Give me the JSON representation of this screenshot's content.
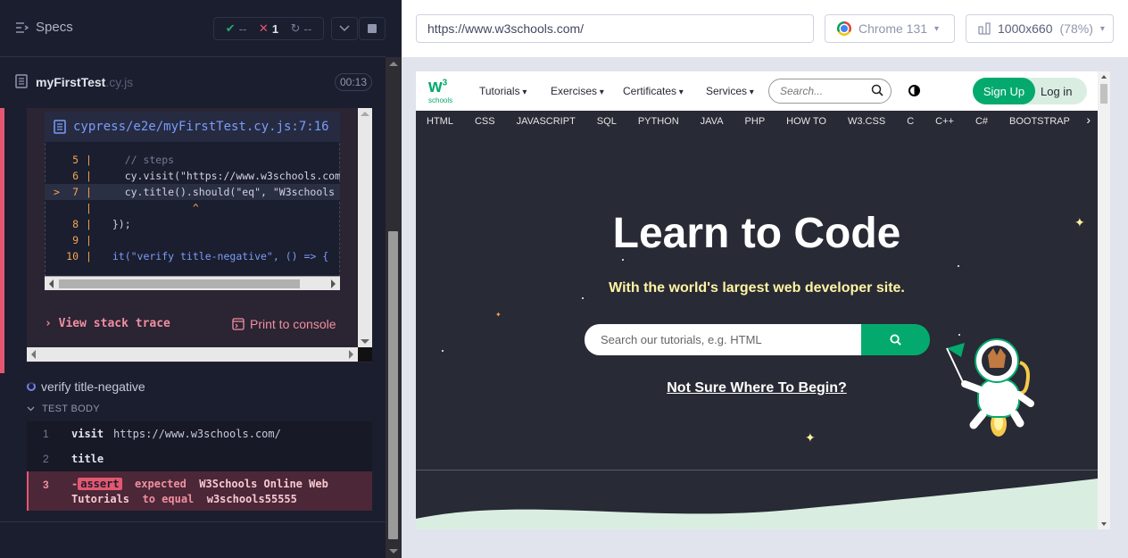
{
  "reporter": {
    "specs_label": "Specs",
    "stats": {
      "passed": "--",
      "failed": "1",
      "pending": "--"
    },
    "spec_file": {
      "name": "myFirstTest",
      "ext": ".cy.js",
      "duration": "00:13"
    },
    "error": {
      "location": "cypress/e2e/myFirstTest.cy.js:7:16",
      "code_lines": [
        {
          "num": "5",
          "text": "    // steps"
        },
        {
          "num": "6",
          "text": "    cy.visit(\"https://www.w3schools.com"
        },
        {
          "num": "7",
          "text": "    cy.title().should(\"eq\", \"W3schools"
        },
        {
          "num": "",
          "text": "               ^"
        },
        {
          "num": "8",
          "text": "  });"
        },
        {
          "num": "9",
          "text": ""
        },
        {
          "num": "10",
          "text": "  it(\"verify title-negative\", () => {"
        }
      ],
      "view_stack_trace": "View stack trace",
      "print_to_console": "Print to console"
    },
    "test": {
      "title": "verify title-negative",
      "body_label": "TEST BODY",
      "commands": [
        {
          "num": "1",
          "name": "visit",
          "message": "https://www.w3schools.com/"
        },
        {
          "num": "2",
          "name": "title",
          "message": ""
        }
      ],
      "failed_command": {
        "num": "3",
        "prefix": "-",
        "name": "assert",
        "word1": "expected",
        "actual": "W3Schools Online Web",
        "actual2": "Tutorials",
        "word2": "to equal",
        "expected": "w3schools55555"
      }
    }
  },
  "aut": {
    "url": "https://www.w3schools.com/",
    "browser": "Chrome 131",
    "viewport": "1000x660",
    "scale": "(78%)"
  },
  "site": {
    "logo_text": "W3",
    "logo_sup": "3",
    "logo_sub": "schools",
    "nav": [
      "Tutorials",
      "Exercises",
      "Certificates",
      "Services"
    ],
    "search_placeholder": "Search...",
    "signup": "Sign Up",
    "login": "Log in",
    "topics": [
      "HTML",
      "CSS",
      "JAVASCRIPT",
      "SQL",
      "PYTHON",
      "JAVA",
      "PHP",
      "HOW TO",
      "W3.CSS",
      "C",
      "C++",
      "C#",
      "BOOTSTRAP"
    ],
    "hero_title": "Learn to Code",
    "hero_subtitle": "With the world's largest web developer site.",
    "hero_search_placeholder": "Search our tutorials, e.g. HTML",
    "hero_link": "Not Sure Where To Begin?"
  },
  "colors": {
    "fail": "#e45770",
    "pass": "#1fa971",
    "w3_green": "#04aa6d",
    "w3_dark": "#282a35"
  },
  "icons": [
    "specs-icon",
    "check-icon",
    "x-icon",
    "spinner-icon",
    "chevron-down-icon",
    "stop-icon",
    "file-icon",
    "chrome-icon",
    "viewport-icon",
    "search-icon",
    "contrast-icon"
  ]
}
